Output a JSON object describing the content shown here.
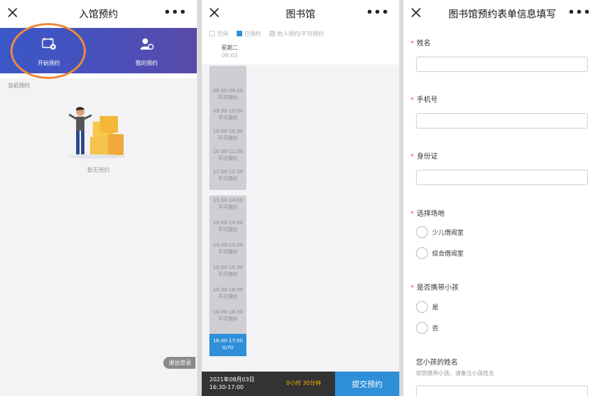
{
  "panel1": {
    "title": "入馆预约",
    "more": "•••",
    "hero": {
      "start_label": "开始预约",
      "mine_label": "我的预约"
    },
    "current_label": "当前预约",
    "empty_text": "暂无预约",
    "logout_label": "退出登录",
    "highlight_color": "#ef8a3a"
  },
  "panel2": {
    "title": "图书馆",
    "more": "•••",
    "legend": [
      "空闲",
      "已预约",
      "他人预约/不可预约"
    ],
    "day": {
      "weekday": "星期二",
      "date": "08.03"
    },
    "slots_top": [
      {
        "time": "",
        "status": ""
      },
      {
        "time": "09:00-09:30",
        "status": "不可预约"
      },
      {
        "time": "09:30-10:00",
        "status": "不可预约"
      },
      {
        "time": "10:00-10:30",
        "status": "不可预约"
      },
      {
        "time": "10:30-11:00",
        "status": "不可预约"
      },
      {
        "time": "11:00-11:30",
        "status": "不可预约"
      }
    ],
    "slots_bottom": [
      {
        "time": "13:30-14:00",
        "status": "不可预约"
      },
      {
        "time": "14:00-14:30",
        "status": "不可预约"
      },
      {
        "time": "14:30-15:00",
        "status": "不可预约"
      },
      {
        "time": "15:00-15:30",
        "status": "不可预约"
      },
      {
        "time": "15:30-16:00",
        "status": "不可预约"
      },
      {
        "time": "16:00-16:30",
        "status": "不可预约"
      }
    ],
    "selected_slot": {
      "time": "16:30-17:00",
      "status": "0/70"
    },
    "bottom": {
      "date": "2021年08月03日",
      "time": "16:30-17:00",
      "duration": "0小时 30分钟",
      "submit": "提交预约"
    },
    "accent": "#2f8fd8"
  },
  "panel3": {
    "title": "图书馆预约表单信息填写",
    "more": "•••",
    "name_label": "姓名",
    "phone_label": "手机号",
    "id_label": "身份证",
    "venue_label": "选择场地",
    "venue_options": [
      "少儿借阅室",
      "综合借阅室"
    ],
    "child_label": "是否携带小孩",
    "child_options": [
      "是",
      "否"
    ],
    "child_name_label": "您小孩的姓名",
    "child_name_hint": "如您携带小孩，请备注小孩姓名",
    "required_mark": "*"
  }
}
